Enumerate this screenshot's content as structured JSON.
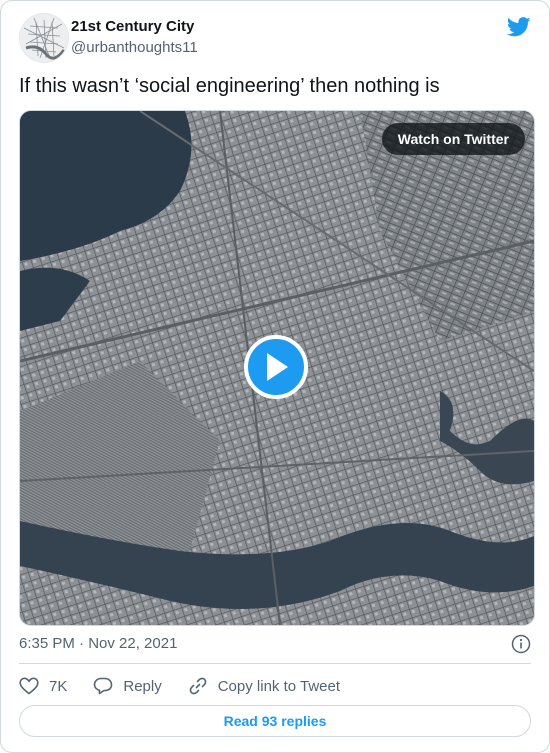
{
  "author": {
    "display_name": "21st Century City",
    "handle": "@urbanthoughts11",
    "avatar_icon": "city-map-avatar"
  },
  "tweet": {
    "text": "If this wasn’t ‘social engineering’ then nothing is",
    "timestamp": "6:35 PM · Nov 22, 2021"
  },
  "media": {
    "watch_label": "Watch on Twitter",
    "play_icon": "play-icon"
  },
  "actions": {
    "likes": "7K",
    "reply_label": "Reply",
    "copy_label": "Copy link to Tweet"
  },
  "footer": {
    "read_replies_label": "Read 93 replies"
  },
  "colors": {
    "brand": "#1d9bf0",
    "text": "#0f1419",
    "secondary": "#536471",
    "border": "#cfd9de"
  }
}
